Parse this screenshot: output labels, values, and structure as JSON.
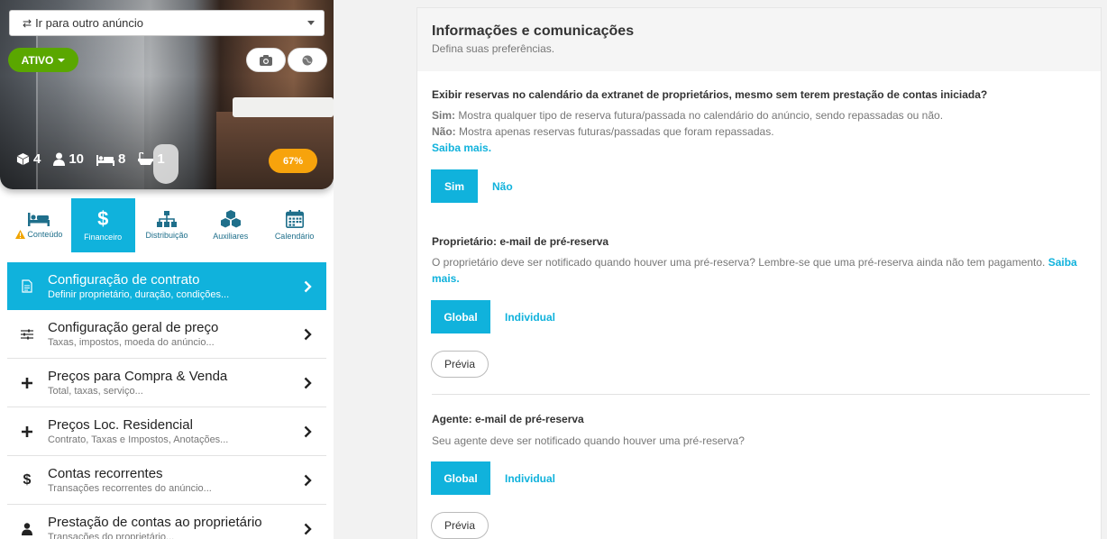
{
  "header_listing": {
    "goto_label": "Ir para outro anúncio",
    "status_label": "ATIVO",
    "stats": {
      "units": "4",
      "guests": "10",
      "beds": "8",
      "baths": "1"
    },
    "completion": "67%"
  },
  "tabs": [
    {
      "label": "Conteúdo",
      "warning": true
    },
    {
      "label": "Financeiro",
      "active": true
    },
    {
      "label": "Distribuição"
    },
    {
      "label": "Auxiliares"
    },
    {
      "label": "Calendário"
    }
  ],
  "menu": [
    {
      "title": "Configuração de contrato",
      "subtitle": "Definir proprietário, duração, condições...",
      "icon": "document-icon"
    },
    {
      "title": "Configuração geral de preço",
      "subtitle": "Taxas, impostos, moeda do anúncio...",
      "icon": "sliders-icon"
    },
    {
      "title": "Preços para Compra & Venda",
      "subtitle": "Total, taxas, serviço...",
      "icon": "plus-icon"
    },
    {
      "title": "Preços Loc. Residencial",
      "subtitle": "Contrato, Taxas e Impostos, Anotações...",
      "icon": "plus-icon"
    },
    {
      "title": "Contas recorrentes",
      "subtitle": "Transações recorrentes do anúncio...",
      "icon": "dollar-icon"
    },
    {
      "title": "Prestação de contas ao proprietário",
      "subtitle": "Transações do proprietário...",
      "icon": "user-icon"
    }
  ],
  "main": {
    "title": "Informações e comunicações",
    "subtitle": "Defina suas preferências.",
    "q1": {
      "question": "Exibir reservas no calendário da extranet de proprietários, mesmo sem terem prestação de contas iniciada?",
      "sim_key": "Sim:",
      "sim_text": " Mostra qualquer tipo de reserva futura/passada no calendário do anúncio, sendo repassadas ou não.",
      "nao_key": "Não:",
      "nao_text": " Mostra apenas reservas futuras/passadas que foram repassadas.",
      "learn_more": "Saiba mais.",
      "option_selected": "Sim",
      "option_other": "Não"
    },
    "q2": {
      "question": "Proprietário: e-mail de pré-reserva",
      "desc": "O proprietário deve ser notificado quando houver uma pré-reserva? Lembre-se que uma pré-reserva ainda não tem pagamento. ",
      "learn_more": "Saiba mais.",
      "option_selected": "Global",
      "option_other": "Individual",
      "preview": "Prévia"
    },
    "q3": {
      "question": "Agente: e-mail de pré-reserva",
      "desc": "Seu agente deve ser notificado quando houver uma pré-reserva?",
      "option_selected": "Global",
      "option_other": "Individual",
      "preview": "Prévia"
    }
  },
  "colors": {
    "accent": "#10b2dc",
    "status_green": "#5aa700",
    "completion_orange": "#f7a30c",
    "warning": "#f0a400"
  }
}
